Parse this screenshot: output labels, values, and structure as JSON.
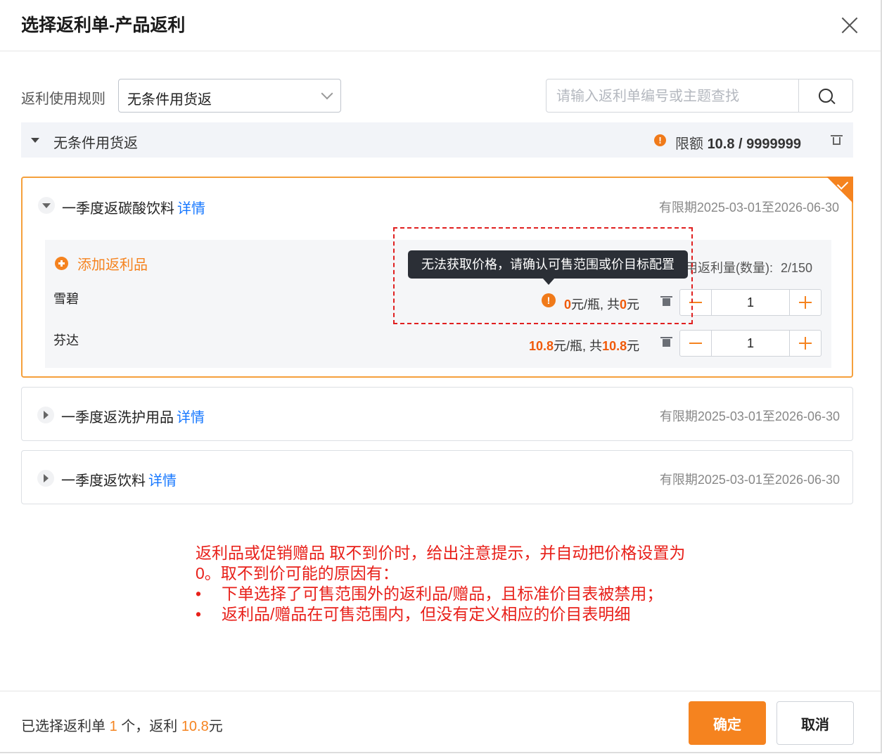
{
  "dialog": {
    "title": "选择返利单-产品返利"
  },
  "filter": {
    "rule_label": "返利使用规则",
    "rule_value": "无条件用货返",
    "search_placeholder": "请输入返利单编号或主题查找"
  },
  "group": {
    "name": "无条件用货返",
    "quota_label": "限额",
    "quota_value": "10.8 / 9999999"
  },
  "cards": [
    {
      "name": "一季度返碳酸饮料",
      "detail_link": "详情",
      "period": "有限期2025-03-01至2026-06-30",
      "add_label": "添加返利品",
      "usage_label": "用返利量(数量):",
      "usage_value": "2/150",
      "products": [
        {
          "name": "雪碧",
          "unit_price": "0",
          "price_unit": "元/瓶, 共",
          "total": "0",
          "total_unit": "元",
          "qty": "1"
        },
        {
          "name": "芬达",
          "unit_price": "10.8",
          "price_unit": "元/瓶, 共",
          "total": "10.8",
          "total_unit": "元",
          "qty": "1"
        }
      ]
    },
    {
      "name": "一季度返洗护用品",
      "detail_link": "详情",
      "period": "有限期2025-03-01至2026-06-30"
    },
    {
      "name": "一季度返饮料",
      "detail_link": "详情",
      "period": "有限期2025-03-01至2026-06-30"
    }
  ],
  "tooltip": {
    "text": "无法获取价格，请确认可售范围或价目标配置"
  },
  "annotation": {
    "line1": "返利品或促销赠品 取不到价时，给出注意提示，并自动把价格设置为0。取不到价可能的原因有：",
    "bullets": [
      "下单选择了可售范围外的返利品/赠品，且标准价目表被禁用；",
      "返利品/赠品在可售范围内，但没有定义相应的价目表明细"
    ]
  },
  "footer": {
    "summary_prefix": "已选择返利单",
    "count": "1",
    "summary_mid": "个，返利",
    "amount": "10.8",
    "summary_suffix": "元",
    "confirm_label": "确定",
    "cancel_label": "取消"
  },
  "colors": {
    "accent": "#f5831f",
    "link": "#1677ff",
    "warning_text": "#e8201a"
  }
}
